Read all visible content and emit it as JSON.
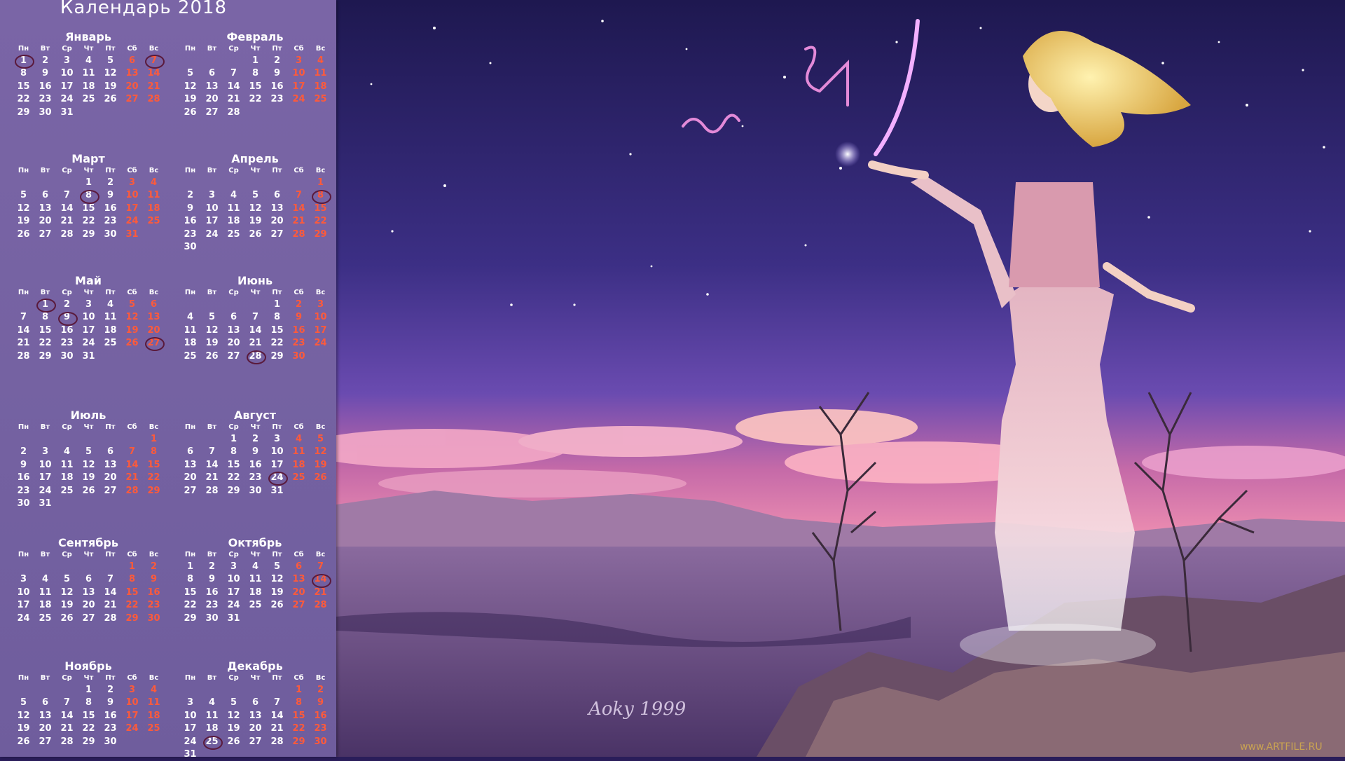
{
  "calendar": {
    "title": "Календарь 2018",
    "weekdays": [
      "Пн",
      "Вт",
      "Ср",
      "Чт",
      "Пт",
      "Сб",
      "Вс"
    ],
    "months": [
      {
        "name": "Январь",
        "offset": 0,
        "days": 31,
        "marked": [
          1,
          7
        ]
      },
      {
        "name": "Февраль",
        "offset": 3,
        "days": 28,
        "marked": []
      },
      {
        "name": "Март",
        "offset": 3,
        "days": 31,
        "marked": [
          8
        ]
      },
      {
        "name": "Апрель",
        "offset": 6,
        "days": 30,
        "marked": [
          8
        ]
      },
      {
        "name": "Май",
        "offset": 1,
        "days": 31,
        "marked": [
          1,
          9,
          27
        ]
      },
      {
        "name": "Июнь",
        "offset": 4,
        "days": 30,
        "marked": [
          28
        ]
      },
      {
        "name": "Июль",
        "offset": 6,
        "days": 31,
        "marked": []
      },
      {
        "name": "Август",
        "offset": 2,
        "days": 31,
        "marked": [
          24
        ]
      },
      {
        "name": "Сентябрь",
        "offset": 5,
        "days": 30,
        "marked": []
      },
      {
        "name": "Октябрь",
        "offset": 0,
        "days": 31,
        "marked": [
          14
        ]
      },
      {
        "name": "Ноябрь",
        "offset": 3,
        "days": 30,
        "marked": []
      },
      {
        "name": "Декабрь",
        "offset": 5,
        "days": 31,
        "marked": [
          25
        ]
      }
    ]
  },
  "artwork": {
    "signature": "Aoky 1999",
    "watermark": "www.ARTFILE.RU"
  },
  "colors": {
    "panel": "#7562a2",
    "weekend": "#ff5a3a",
    "text": "#ffffff",
    "marker": "#5a1a3c"
  }
}
